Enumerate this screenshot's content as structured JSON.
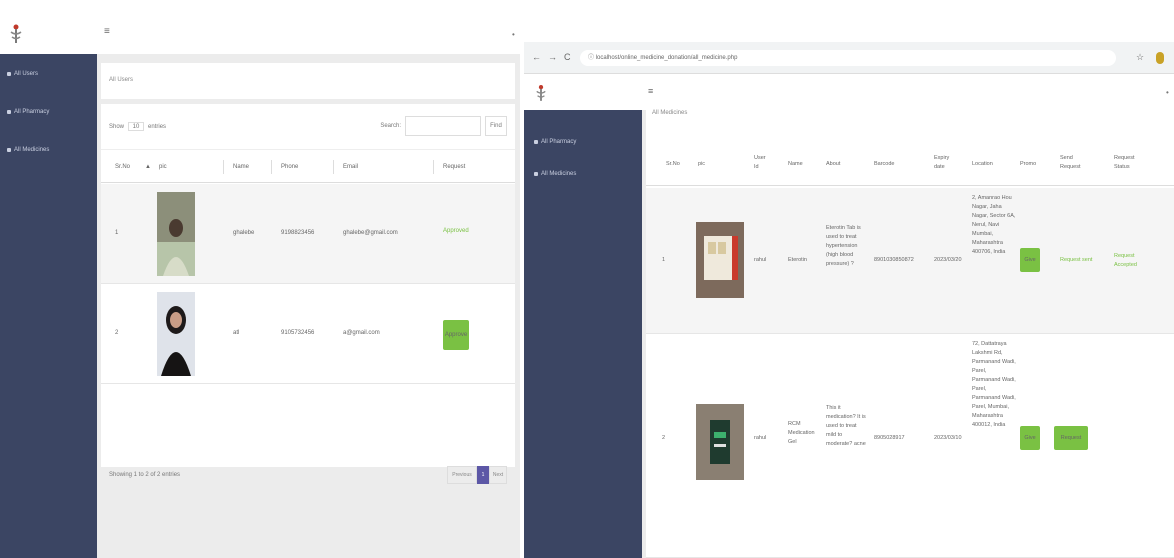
{
  "colors": {
    "sidebar": "#3b4563",
    "accent_green": "#7ac143",
    "pager_active": "#5c57a6"
  },
  "left": {
    "menu_icon": "≡",
    "dot": "•",
    "sidebar": [
      {
        "label": "All Users",
        "icon": "square-icon"
      },
      {
        "label": "All Pharmacy",
        "icon": "square-icon"
      },
      {
        "label": "All Medicines",
        "icon": "square-icon"
      }
    ],
    "breadcrumb": "All Users",
    "show_prefix": "Show",
    "show_value": "10",
    "show_suffix": "entries",
    "search_label": "Search:",
    "search_button": "Find",
    "columns": [
      "Sr.No",
      "pic",
      "Name",
      "Phone",
      "Email",
      "Request"
    ],
    "rows": [
      {
        "sr": "1",
        "name": "ghalebe",
        "phone": "9198823456",
        "email": "ghalebe@gmail.com",
        "request": "Approved",
        "request_type": "text"
      },
      {
        "sr": "2",
        "name": "atl",
        "phone": "9105732456",
        "email": "a@gmail.com",
        "request": "Approve",
        "request_type": "button"
      }
    ],
    "footer": "Showing 1 to 2 of 2 entries",
    "pager": {
      "prev": "Previous",
      "current": "1",
      "next": "Next"
    }
  },
  "right": {
    "browser": {
      "back": "←",
      "forward": "→",
      "reload": "C",
      "url": "localhost/online_medicine_donation/all_medicine.php",
      "star": "☆"
    },
    "menu_icon": "≡",
    "dot": "•",
    "sidebar": [
      {
        "label": "All Pharmacy",
        "icon": "square-icon"
      },
      {
        "label": "All Medicines",
        "icon": "square-icon"
      }
    ],
    "section_title": "All Medicines",
    "columns": [
      "Sr.No",
      "pic",
      "User Id",
      "Name",
      "About",
      "Barcode",
      "Expiry date",
      "Location",
      "Promo",
      "Send Request",
      "Request Status"
    ],
    "rows": [
      {
        "sr": "1",
        "user": "rahul",
        "name": "Eterotin",
        "about": "Eterotin Tab is used to treat hypertension (high blood pressure) ?",
        "barcode": "8901030850872",
        "expiry": "2023/03/20",
        "location": "2, Amanrao Hou Nagar, Jaha Nagar, Sector 6A, Nerul, Navi Mumbai, Maharashtra 400706, India",
        "promo": "Give",
        "send": "Request sent",
        "send_type": "text",
        "status": "Request Accepted"
      },
      {
        "sr": "2",
        "user": "rahul",
        "name": "RCM Medication Gel",
        "about": "This it medication? It is used to treat mild to moderate? acne",
        "barcode": "8905028917",
        "expiry": "2023/03/10",
        "location": "72, Dattatraya Lakshmi Rd, Parmanand Wadi, Parel, Parmanand Wadi, Parel, Parmanand Wadi, Parel, Mumbai, Maharashtra 400012, India",
        "promo": "Give",
        "send": "Request",
        "send_type": "button",
        "status": ""
      }
    ]
  }
}
